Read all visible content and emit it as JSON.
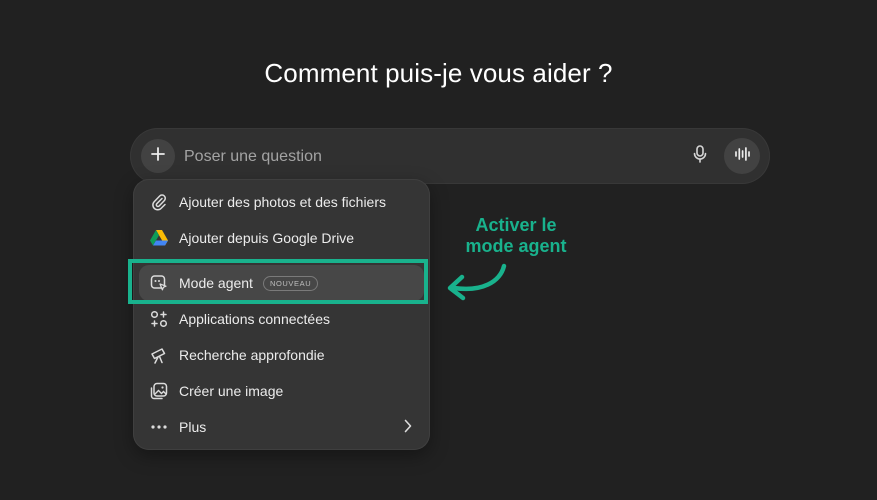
{
  "heading": "Comment puis-je vous aider ?",
  "composer": {
    "placeholder": "Poser une question",
    "plus_icon": "plus-icon",
    "mic_icon": "microphone-icon",
    "voice_icon": "voice-waveform-icon"
  },
  "menu": {
    "items": [
      {
        "label": "Ajouter des photos et des fichiers",
        "icon": "paperclip-icon"
      },
      {
        "label": "Ajouter depuis Google Drive",
        "icon": "google-drive-icon"
      },
      {
        "label": "Mode agent",
        "icon": "agent-mode-icon",
        "badge": "NOUVEAU",
        "active": true
      },
      {
        "label": "Applications connectées",
        "icon": "connected-apps-icon"
      },
      {
        "label": "Recherche approfondie",
        "icon": "telescope-icon"
      },
      {
        "label": "Créer une image",
        "icon": "image-create-icon"
      },
      {
        "label": "Plus",
        "icon": "more-dots-icon",
        "submenu_icon": "chevron-right-icon"
      }
    ]
  },
  "annotation": {
    "line1": "Activer le",
    "line2": "mode agent",
    "color": "#19b28d"
  },
  "colors": {
    "background": "#212121",
    "composer": "#303030",
    "menu": "#353535",
    "accent": "#19b28d"
  }
}
